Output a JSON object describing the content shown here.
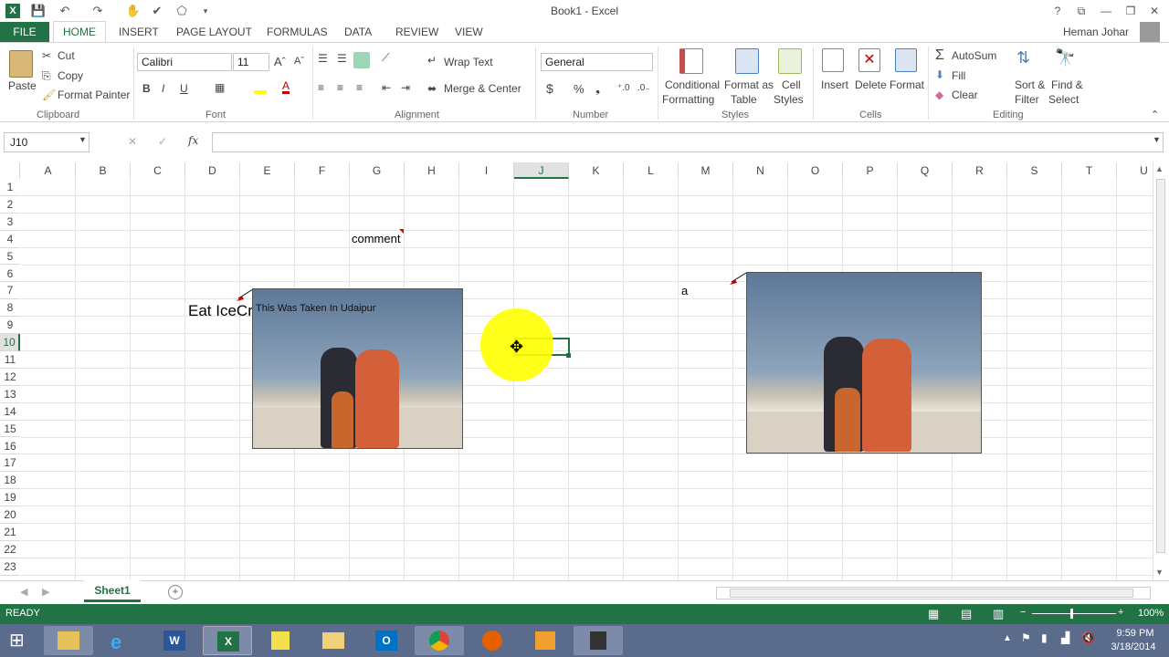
{
  "window": {
    "title": "Book1 - Excel",
    "user": "Heman Johar"
  },
  "menu_tabs": [
    "FILE",
    "HOME",
    "INSERT",
    "PAGE LAYOUT",
    "FORMULAS",
    "DATA",
    "REVIEW",
    "VIEW"
  ],
  "clipboard": {
    "paste": "Paste",
    "cut": "Cut",
    "copy": "Copy",
    "format_painter": "Format Painter",
    "label": "Clipboard"
  },
  "font": {
    "name": "Calibri",
    "size": "11",
    "label": "Font",
    "bold": "B",
    "italic": "I",
    "underline": "U"
  },
  "alignment": {
    "wrap": "Wrap Text",
    "merge": "Merge & Center",
    "label": "Alignment"
  },
  "number": {
    "format": "General",
    "label": "Number",
    "currency": "$",
    "percent": "%",
    "comma": "❟"
  },
  "styles": {
    "conditional1": "Conditional",
    "conditional2": "Formatting",
    "format_table1": "Format as",
    "format_table2": "Table",
    "cell_styles1": "Cell",
    "cell_styles2": "Styles",
    "label": "Styles"
  },
  "cells": {
    "insert": "Insert",
    "delete": "Delete",
    "format": "Format",
    "label": "Cells"
  },
  "editing": {
    "autosum": "AutoSum",
    "fill": "Fill",
    "clear": "Clear",
    "sort1": "Sort &",
    "sort2": "Filter",
    "find1": "Find &",
    "find2": "Select",
    "label": "Editing"
  },
  "formula_bar": {
    "name_box": "J10",
    "fx": "fx",
    "value": ""
  },
  "columns": [
    "A",
    "B",
    "C",
    "D",
    "E",
    "F",
    "G",
    "H",
    "I",
    "J",
    "K",
    "L",
    "M",
    "N",
    "O",
    "P",
    "Q",
    "R",
    "S",
    "T",
    "U"
  ],
  "rows": [
    "1",
    "2",
    "3",
    "4",
    "5",
    "6",
    "7",
    "8",
    "9",
    "10",
    "11",
    "12",
    "13",
    "14",
    "15",
    "16",
    "17",
    "18",
    "19",
    "20",
    "21",
    "22",
    "23"
  ],
  "selected_cell": "J10",
  "cells_content": {
    "G4": "comment",
    "D8": "Eat IceCr",
    "M7": "a"
  },
  "comment_picture": {
    "caption": "This Was Taken In Udaipur"
  },
  "sheet_tabs": [
    "Sheet1"
  ],
  "status": {
    "ready": "READY",
    "zoom": "100%",
    "minus": "−",
    "plus": "+"
  },
  "clock": {
    "time": "9:59 PM",
    "date": "3/18/2014"
  },
  "colors": {
    "excel_green": "#217346",
    "selection": "#217346",
    "highlight": "#ffff00"
  }
}
